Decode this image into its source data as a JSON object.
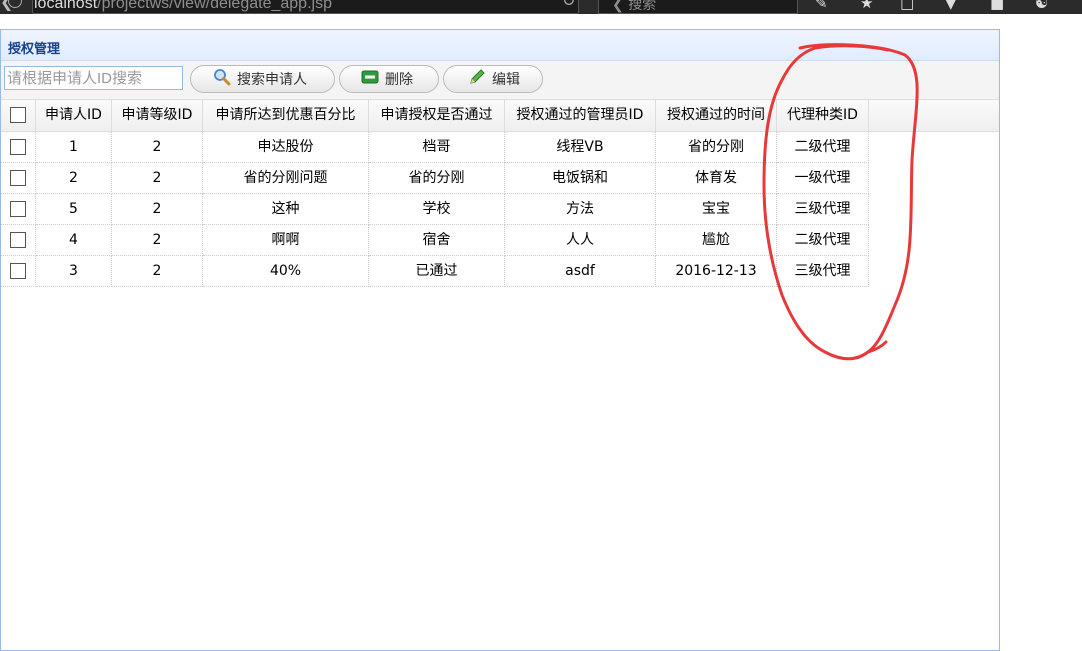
{
  "browser": {
    "url_host": "localhost",
    "url_path": "/projectws/view/delegate_app.jsp",
    "search_placeholder": "搜索"
  },
  "panel": {
    "title": "授权管理"
  },
  "toolbar": {
    "search_placeholder": "请根据申请人ID搜索",
    "search_button": "搜索申请人",
    "delete_button": "删除",
    "edit_button": "编辑"
  },
  "table": {
    "columns": [
      "申请人ID",
      "申请等级ID",
      "申请所达到优惠百分比",
      "申请授权是否通过",
      "授权通过的管理员ID",
      "授权通过的时间",
      "代理种类ID"
    ],
    "rows": [
      [
        "1",
        "2",
        "申达股份",
        "档哥",
        "线程VB",
        "省的分刚",
        "二级代理"
      ],
      [
        "2",
        "2",
        "省的分刚问题",
        "省的分刚",
        "电饭锅和",
        "体育发",
        "一级代理"
      ],
      [
        "5",
        "2",
        "这种",
        "学校",
        "方法",
        "宝宝",
        "三级代理"
      ],
      [
        "4",
        "2",
        "啊啊",
        "宿舍",
        "人人",
        "尴尬",
        "二级代理"
      ],
      [
        "3",
        "2",
        "40%",
        "已通过",
        "asdf",
        "2016-12-13",
        "三级代理"
      ]
    ]
  },
  "colors": {
    "annotation": "#e8393a",
    "title": "#15428b",
    "header_bg": "#e0ecff"
  },
  "icons": {
    "search": "magnifier-icon",
    "delete": "minus-box-icon",
    "edit": "pencil-icon"
  }
}
